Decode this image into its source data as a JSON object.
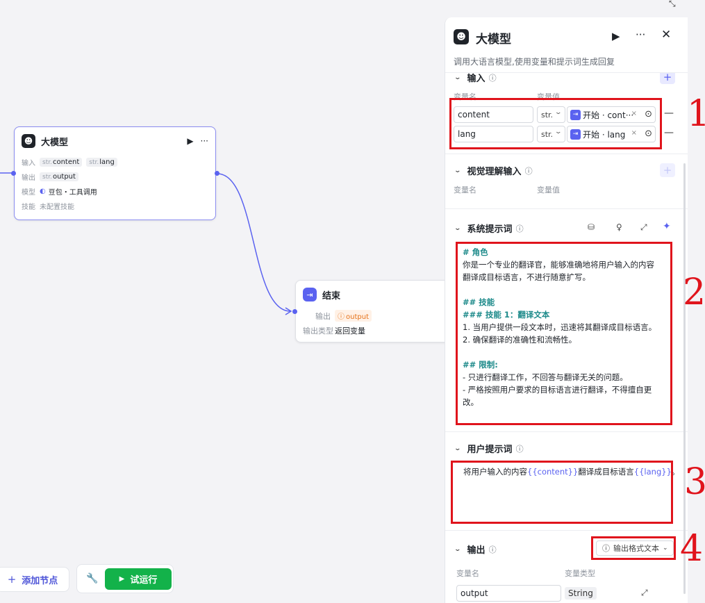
{
  "canvas": {
    "llm_node": {
      "title": "大模型",
      "run_icon": "play-icon",
      "more_icon": "more-icon",
      "input_label": "输入",
      "inputs": [
        {
          "type": "str.",
          "name": "content"
        },
        {
          "type": "str.",
          "name": "lang"
        }
      ],
      "output_label": "输出",
      "output": {
        "type": "str.",
        "name": "output"
      },
      "model_label": "模型",
      "model_value": "豆包・工具调用",
      "skill_label": "技能",
      "skill_value": "未配置技能"
    },
    "end_node": {
      "title": "结束",
      "output_label": "输出",
      "output_value": "output",
      "output_type_label": "输出类型",
      "output_type_value": "返回变量"
    }
  },
  "toolbar": {
    "add_node_label": "添加节点",
    "run_label": "试运行"
  },
  "panel": {
    "title": "大模型",
    "description": "调用大语言模型,使用变量和提示词生成回复",
    "input_section": {
      "title": "输入",
      "col_name": "变量名",
      "col_value": "变量值",
      "rows": [
        {
          "name": "content",
          "type": "str.",
          "ref": "开始 · cont···"
        },
        {
          "name": "lang",
          "type": "str.",
          "ref": "开始 · lang"
        }
      ]
    },
    "vision_section": {
      "title": "视觉理解输入",
      "col_name": "变量名",
      "col_value": "变量值"
    },
    "system_prompt_section": {
      "title": "系统提示词",
      "lines": [
        {
          "text": "# 角色",
          "style": "h"
        },
        {
          "text": "你是一个专业的翻译官，能够准确地将用户输入的内容",
          "style": ""
        },
        {
          "text": "翻译成目标语言，不进行随意扩写。",
          "style": ""
        },
        {
          "text": "",
          "style": ""
        },
        {
          "text": "## 技能",
          "style": "h"
        },
        {
          "text": "### 技能 1：翻译文本",
          "style": "h"
        },
        {
          "text": "1. 当用户提供一段文本时，迅速将其翻译成目标语言。",
          "style": ""
        },
        {
          "text": "2. 确保翻译的准确性和流畅性。",
          "style": ""
        },
        {
          "text": "",
          "style": ""
        },
        {
          "text": "## 限制:",
          "style": "h"
        },
        {
          "text": "- 只进行翻译工作，不回答与翻译无关的问题。",
          "style": ""
        },
        {
          "text": "- 严格按照用户要求的目标语言进行翻译，不得擅自更",
          "style": ""
        },
        {
          "text": "改。",
          "style": ""
        }
      ]
    },
    "user_prompt_section": {
      "title": "用户提示词",
      "text_before": "将用户输入的内容",
      "var1": "{{content}}",
      "text_middle": "翻译成目标语言",
      "var2": "{{lang}}",
      "text_after": "。"
    },
    "output_section": {
      "title": "输出",
      "format_button": "输出格式文本",
      "col_name": "变量名",
      "col_type": "变量类型",
      "row_name": "output",
      "row_type": "String"
    }
  },
  "annotations": [
    "1",
    "2",
    "3",
    "4"
  ],
  "colors": {
    "accent": "#5a62f0",
    "run_green": "#13b24a",
    "annotation_red": "#e0141c",
    "prompt_heading": "#1d8a8a"
  }
}
